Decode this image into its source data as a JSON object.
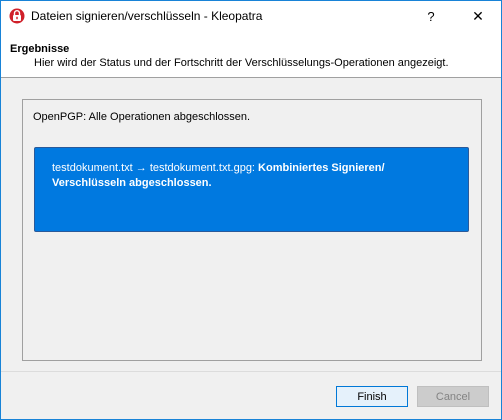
{
  "window": {
    "title": "Dateien signieren/verschlüsseln - Kleopatra",
    "help_label": "?",
    "close_label": "✕"
  },
  "header": {
    "title": "Ergebnisse",
    "subtitle": "Hier wird der Status und der Fortschritt der Verschlüsselungs-Operationen angezeigt."
  },
  "main": {
    "status": "OpenPGP: Alle Operationen abgeschlossen.",
    "result": {
      "file_prefix": "testdokument.txt → testdokument.txt.gpg: ",
      "message": "Kombiniertes Signieren/ Verschlüsseln abgeschlossen."
    }
  },
  "buttons": {
    "finish": "Finish",
    "cancel": "Cancel"
  },
  "colors": {
    "accent": "#0079e0",
    "window_border": "#1883d7",
    "app_icon": "#d0202a"
  },
  "icons": {
    "app": "kleopatra-icon"
  }
}
